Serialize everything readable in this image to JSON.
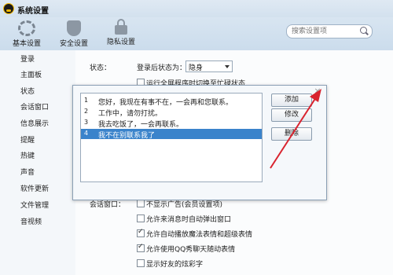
{
  "window": {
    "title": "系统设置"
  },
  "toolbar": {
    "basic_label": "基本设置",
    "security_label": "安全设置",
    "privacy_label": "隐私设置"
  },
  "search": {
    "placeholder": "搜索设置项"
  },
  "sidebar": {
    "items": [
      {
        "label": "登录"
      },
      {
        "label": "主面板"
      },
      {
        "label": "状态"
      },
      {
        "label": "会话窗口"
      },
      {
        "label": "信息展示"
      },
      {
        "label": "提醒"
      },
      {
        "label": "热键"
      },
      {
        "label": "声音"
      },
      {
        "label": "软件更新"
      },
      {
        "label": "文件管理"
      },
      {
        "label": "音视频"
      }
    ]
  },
  "status_section": {
    "section_label": "状态：",
    "login_status_label": "登录后状态为：",
    "login_status_value": "隐身",
    "fullscreen_option": "运行全屏程序时切换至忙碌状态"
  },
  "session_section": {
    "section_label": "会话窗口：",
    "options": [
      {
        "label": "不显示广告(会员设置项)",
        "checked": false
      },
      {
        "label": "允许来消息时自动弹出窗口",
        "checked": false
      },
      {
        "label": "允许自动播放魔法表情和超级表情",
        "checked": true
      },
      {
        "label": "允许使用QQ秀聊天随动表情",
        "checked": true
      },
      {
        "label": "显示好友的炫彩字",
        "checked": false
      }
    ]
  },
  "reply_dialog": {
    "items": [
      {
        "num": "1",
        "text": "您好，我现在有事不在，一会再和您联系。",
        "selected": false
      },
      {
        "num": "2",
        "text": "工作中，请勿打扰。",
        "selected": false
      },
      {
        "num": "3",
        "text": "我去吃饭了，一会再联系。",
        "selected": false
      },
      {
        "num": "4",
        "text": "我不在别联系我了",
        "selected": true
      }
    ],
    "add_label": "添加",
    "edit_label": "修改",
    "delete_label": "删除",
    "close_glyph": "×"
  },
  "colors": {
    "selection": "#3a83cb",
    "annotation_arrow": "#d9232e"
  }
}
